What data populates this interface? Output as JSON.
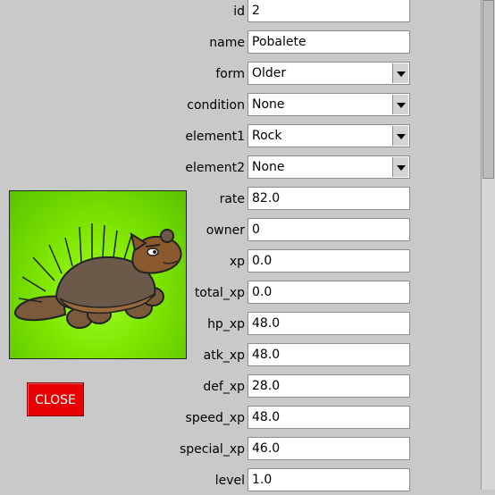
{
  "fields": [
    {
      "key": "id",
      "label": "id",
      "value": "2",
      "type": "text"
    },
    {
      "key": "name",
      "label": "name",
      "value": "Pobalete",
      "type": "text"
    },
    {
      "key": "form",
      "label": "form",
      "value": "Older",
      "type": "select"
    },
    {
      "key": "condition",
      "label": "condition",
      "value": "None",
      "type": "select"
    },
    {
      "key": "element1",
      "label": "element1",
      "value": "Rock",
      "type": "select"
    },
    {
      "key": "element2",
      "label": "element2",
      "value": "None",
      "type": "select"
    },
    {
      "key": "rate",
      "label": "rate",
      "value": "82.0",
      "type": "text"
    },
    {
      "key": "owner",
      "label": "owner",
      "value": "0",
      "type": "text"
    },
    {
      "key": "xp",
      "label": "xp",
      "value": "0.0",
      "type": "text"
    },
    {
      "key": "total_xp",
      "label": "total_xp",
      "value": "0.0",
      "type": "text"
    },
    {
      "key": "hp_xp",
      "label": "hp_xp",
      "value": "48.0",
      "type": "text"
    },
    {
      "key": "atk_xp",
      "label": "atk_xp",
      "value": "48.0",
      "type": "text"
    },
    {
      "key": "def_xp",
      "label": "def_xp",
      "value": "28.0",
      "type": "text"
    },
    {
      "key": "speed_xp",
      "label": "speed_xp",
      "value": "48.0",
      "type": "text"
    },
    {
      "key": "special_xp",
      "label": "special_xp",
      "value": "46.0",
      "type": "text"
    },
    {
      "key": "level",
      "label": "level",
      "value": "1.0",
      "type": "text"
    }
  ],
  "close_button": {
    "label": "CLOSE"
  },
  "colors": {
    "background": "#c9c9c9",
    "close_button": "#e60000",
    "image_background": "#7fe600"
  },
  "icons": {
    "select_arrow": "chevron-down-icon"
  },
  "image": {
    "subject": "pet-creature-illustration"
  }
}
